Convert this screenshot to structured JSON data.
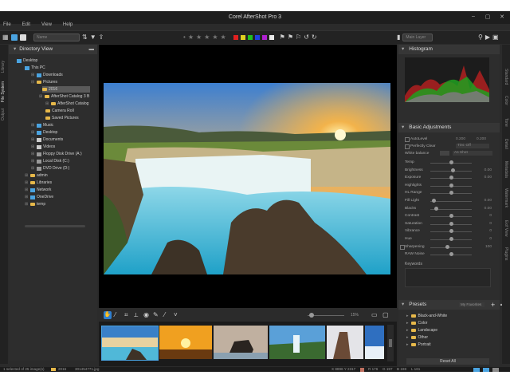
{
  "window": {
    "title": "Corel AfterShot Pro 3",
    "controls": [
      "–",
      "▢",
      "✕"
    ]
  },
  "menu": [
    "File",
    "Edit",
    "View",
    "Help"
  ],
  "toolbar": {
    "combo_left": "Name",
    "combo_right": "Main Layer"
  },
  "rating": {
    "stars": 5
  },
  "color_labels": [
    "#e02020",
    "#e0d020",
    "#20c020",
    "#2040e0",
    "#b020d0",
    "#e8e8e8"
  ],
  "left_rail": [
    "Library",
    "File System",
    "Output"
  ],
  "right_rail": [
    "Standard",
    "Color",
    "Tone",
    "Detail",
    "Metadata",
    "Watermark",
    "Exif View",
    "Plugins"
  ],
  "directory": {
    "title": "Directory View",
    "items": [
      {
        "label": "Desktop",
        "kind": "pc"
      },
      {
        "label": "This PC",
        "kind": "pc"
      },
      {
        "label": "Downloads",
        "kind": "folder"
      },
      {
        "label": "Pictures",
        "kind": "folder"
      },
      {
        "label": "2016",
        "kind": "folder",
        "selected": true
      },
      {
        "label": "AfterShot Catalog 3 B",
        "kind": "folder"
      },
      {
        "label": "AfterShot Catalog",
        "kind": "folder"
      },
      {
        "label": "Camera Roll",
        "kind": "folder"
      },
      {
        "label": "Saved Pictures",
        "kind": "folder"
      },
      {
        "label": "Music",
        "kind": "folder"
      },
      {
        "label": "Desktop",
        "kind": "folder"
      },
      {
        "label": "Documents",
        "kind": "folder"
      },
      {
        "label": "Videos",
        "kind": "folder"
      },
      {
        "label": "Floppy Disk Drive (A:)",
        "kind": "drive"
      },
      {
        "label": "Local Disk (C:)",
        "kind": "drive"
      },
      {
        "label": "DVD Drive (D:)",
        "kind": "drive"
      },
      {
        "label": "admin",
        "kind": "folder"
      },
      {
        "label": "Libraries",
        "kind": "folder"
      },
      {
        "label": "Network",
        "kind": "pc"
      },
      {
        "label": "OneDrive",
        "kind": "pc"
      },
      {
        "label": "temp",
        "kind": "folder"
      }
    ]
  },
  "viewer": {
    "zoom": "15%"
  },
  "histogram": {
    "title": "Histogram"
  },
  "basic_adjustments": {
    "title": "Basic Adjustments",
    "checks": [
      {
        "label": "AutoLevel",
        "v1": "0.200",
        "v2": "0.200"
      },
      {
        "label": "Perfectly Clear",
        "v1": "Tint: Off"
      }
    ],
    "white_balance_label": "White balance",
    "white_balance_value": "As Shot",
    "sliders": [
      {
        "label": "Temp",
        "value": "",
        "pos": 0.5
      },
      {
        "label": "Brightness",
        "value": "0.00",
        "pos": 0.55
      },
      {
        "label": "Exposure",
        "value": "0.00",
        "pos": 0.5
      },
      {
        "label": "Highlights",
        "value": "",
        "pos": 0.5
      },
      {
        "label": "HL Range",
        "value": "",
        "pos": 0.5
      },
      {
        "label": "Fill Light",
        "value": "0.00",
        "pos": 0.05
      },
      {
        "label": "Blacks",
        "value": "0.00",
        "pos": 0.1
      },
      {
        "label": "Contrast",
        "value": "0",
        "pos": 0.5
      },
      {
        "label": "Saturation",
        "value": "0",
        "pos": 0.5
      },
      {
        "label": "Vibrance",
        "value": "0",
        "pos": 0.5
      },
      {
        "label": "Hue",
        "value": "0",
        "pos": 0.5
      },
      {
        "label": "Sharpening",
        "value": "100",
        "pos": 0.4
      },
      {
        "label": "RAW Noise",
        "value": "",
        "pos": 0.5
      }
    ],
    "keywords_label": "Keywords"
  },
  "presets": {
    "title": "Presets",
    "dropdown": "My Favorites",
    "items": [
      "Black-and-White",
      "Color",
      "Landscape",
      "Other",
      "Portrait"
    ],
    "reset": "Reset All"
  },
  "status": {
    "selected": "1 selected of 25 image(s)",
    "folder": "2016",
    "file": "301454771.jpg",
    "dims": "X 8896  Y 2317",
    "r": "R 176",
    "g": "G 197",
    "b": "B 198",
    "l": "L 161"
  }
}
